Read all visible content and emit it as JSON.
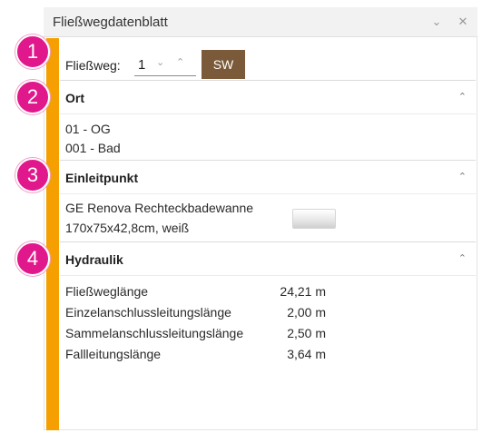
{
  "window": {
    "title": "Fließwegdatenblatt",
    "chevron_icon": "chevron-down-icon",
    "close_icon": "close-icon"
  },
  "flow": {
    "label": "Fließweg:",
    "value": "1",
    "sw_label": "SW"
  },
  "sections": {
    "ort": {
      "title": "Ort",
      "lines": [
        "01 - OG",
        "001 - Bad"
      ]
    },
    "einleitpunkt": {
      "title": "Einleitpunkt",
      "lines": [
        "GE Renova Rechteckbadewanne",
        "170x75x42,8cm, weiß"
      ]
    },
    "hydraulik": {
      "title": "Hydraulik",
      "rows": [
        {
          "label": "Fließweglänge",
          "value": "24,21 m"
        },
        {
          "label": "Einzelanschlussleitungslänge",
          "value": "2,00 m"
        },
        {
          "label": "Sammelanschlussleitungslänge",
          "value": "2,50 m"
        },
        {
          "label": "Fallleitungslänge",
          "value": "3,64 m"
        }
      ]
    }
  },
  "markers": [
    "1",
    "2",
    "3",
    "4"
  ],
  "colors": {
    "accent": "#f5a000",
    "sw_button": "#7a5a38",
    "marker": "#e0188c"
  }
}
